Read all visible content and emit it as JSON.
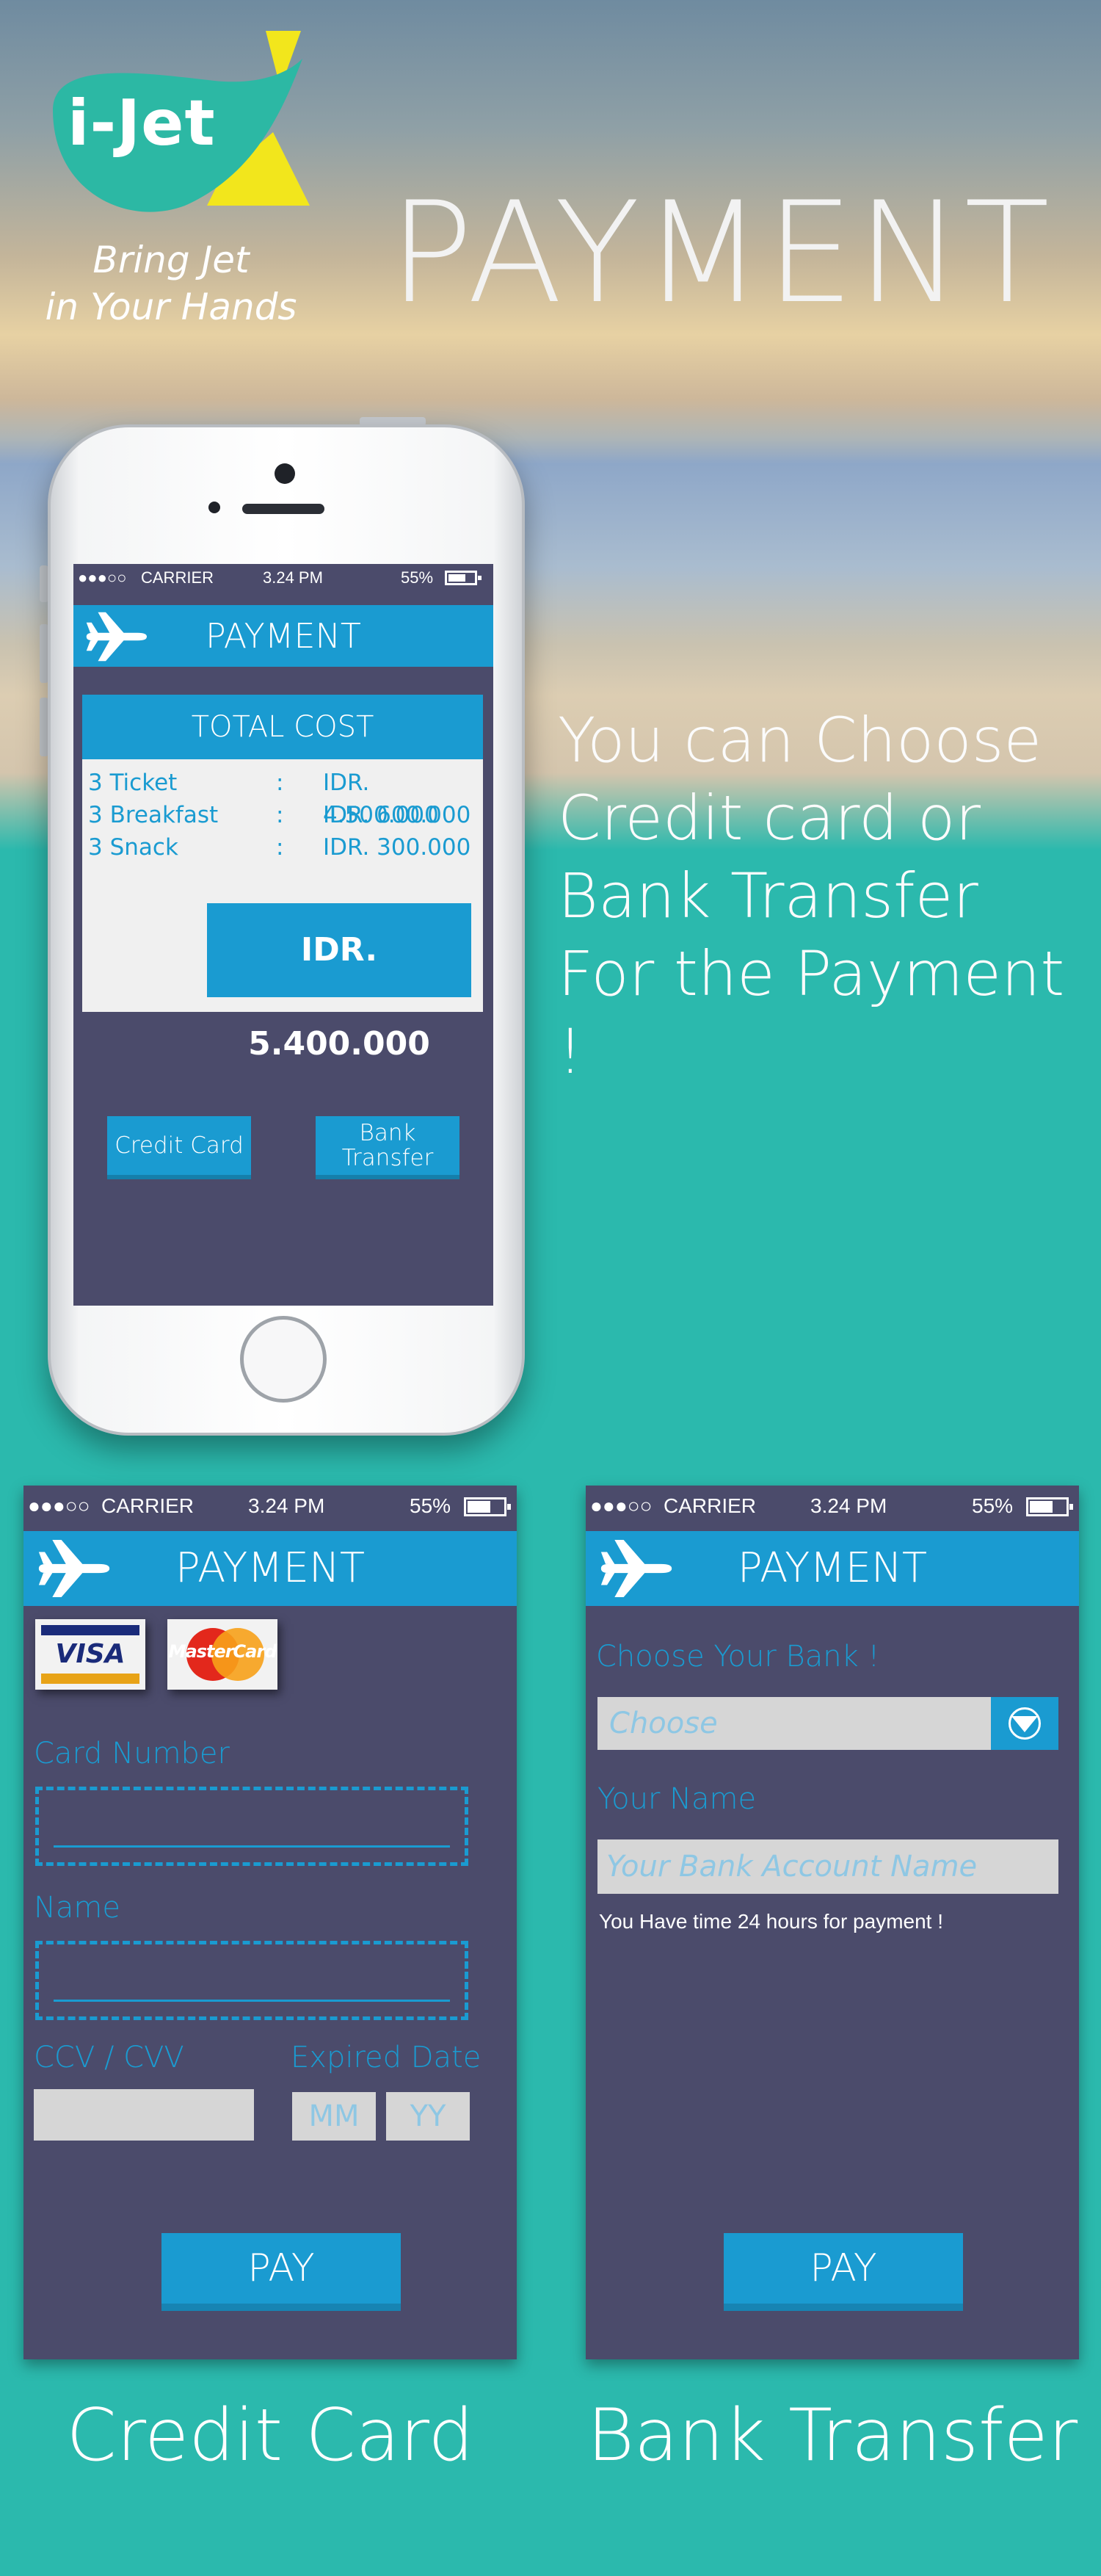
{
  "brand": {
    "name": "i-Jet",
    "tagline_line1": "Bring Jet",
    "tagline_line2": "in Your Hands"
  },
  "headline": "PAYMENT",
  "description": [
    "You can Choose",
    "Credit card or",
    "Bank Transfer",
    "For the Payment !"
  ],
  "status_bar": {
    "signal": "●●●○○",
    "carrier": "CARRIER",
    "time": "3.24 PM",
    "battery": "55%"
  },
  "app_title": "PAYMENT",
  "summary": {
    "header": "TOTAL COST",
    "rows": [
      {
        "item": "3 Ticket",
        "sep": ":",
        "price": "IDR. 4.500.000"
      },
      {
        "item": "3 Breakfast",
        "sep": ":",
        "price": "IDR. 600.000"
      },
      {
        "item": "3 Snack",
        "sep": ":",
        "price": "IDR. 300.000"
      }
    ],
    "total": "IDR. 5.400.000",
    "credit_button": "Credit Card",
    "bank_button_line1": "Bank",
    "bank_button_line2": "Transfer"
  },
  "credit_card_form": {
    "visa": "VISA",
    "mastercard": "MasterCard",
    "card_number_label": "Card Number",
    "name_label": "Name",
    "ccv_label": "CCV / CVV",
    "expired_label": "Expired Date",
    "mm": "MM",
    "yy": "YY",
    "pay": "PAY"
  },
  "bank_form": {
    "choose_label": "Choose Your Bank !",
    "choose_placeholder": "Choose",
    "name_label": "Your Name",
    "name_placeholder": "Your Bank Account Name",
    "note": "You Have time 24 hours for payment !",
    "pay": "PAY"
  },
  "captions": {
    "credit": "Credit Card",
    "bank": "Bank Transfer"
  },
  "colors": {
    "accent": "#1a9bd1",
    "screen_bg": "#4b4b6b",
    "teal": "#2bb9ad",
    "logo_green": "#2cb8a4",
    "logo_yellow": "#f2e61c"
  }
}
